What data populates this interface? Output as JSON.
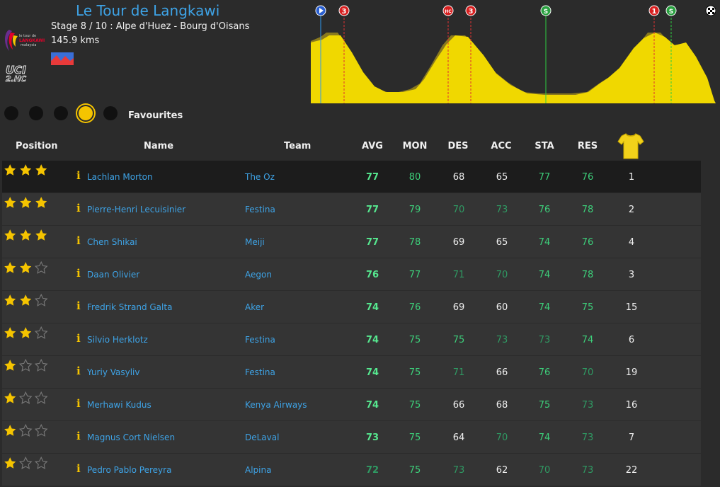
{
  "header": {
    "race_title": "Le Tour de Langkawi",
    "stage": "Stage 8 / 10 : Alpe d'Huez - Bourg d'Oisans",
    "distance": "145.9 kms",
    "race_logo_text": [
      "le tour de",
      "LANGKAWI",
      "malaysia"
    ],
    "uci_logo_text": [
      "UCI",
      "2.HC"
    ]
  },
  "profile": {
    "fill_color": "#f0d800",
    "markers": [
      "start",
      "3",
      "HC",
      "3",
      "S",
      "1",
      "S",
      "finish"
    ]
  },
  "filters": {
    "dots": 5,
    "active_dot": 3,
    "label": "Favourites"
  },
  "table": {
    "columns": {
      "position": "Position",
      "name": "Name",
      "team": "Team",
      "avg": "AVG",
      "mon": "MON",
      "des": "DES",
      "acc": "ACC",
      "sta": "STA",
      "res": "RES"
    },
    "rows": [
      {
        "stars": 3,
        "name": "Lachlan Morton",
        "team": "The Oz",
        "avg": "77",
        "mon": "80",
        "des": "68",
        "acc": "65",
        "sta": "77",
        "res": "76",
        "pos": "1"
      },
      {
        "stars": 3,
        "name": "Pierre-Henri Lecuisinier",
        "team": "Festina",
        "avg": "77",
        "mon": "79",
        "des": "70",
        "acc": "73",
        "sta": "76",
        "res": "78",
        "pos": "2"
      },
      {
        "stars": 3,
        "name": "Chen Shikai",
        "team": "Meiji",
        "avg": "77",
        "mon": "78",
        "des": "69",
        "acc": "65",
        "sta": "74",
        "res": "76",
        "pos": "4"
      },
      {
        "stars": 2,
        "name": "Daan Olivier",
        "team": "Aegon",
        "avg": "76",
        "mon": "77",
        "des": "71",
        "acc": "70",
        "sta": "74",
        "res": "78",
        "pos": "3"
      },
      {
        "stars": 2,
        "name": "Fredrik Strand Galta",
        "team": "Aker",
        "avg": "74",
        "mon": "76",
        "des": "69",
        "acc": "60",
        "sta": "74",
        "res": "75",
        "pos": "15"
      },
      {
        "stars": 2,
        "name": "Silvio Herklotz",
        "team": "Festina",
        "avg": "74",
        "mon": "75",
        "des": "75",
        "acc": "73",
        "sta": "73",
        "res": "74",
        "pos": "6"
      },
      {
        "stars": 1,
        "name": "Yuriy Vasyliv",
        "team": "Festina",
        "avg": "74",
        "mon": "75",
        "des": "71",
        "acc": "66",
        "sta": "76",
        "res": "70",
        "pos": "19"
      },
      {
        "stars": 1,
        "name": "Merhawi Kudus",
        "team": "Kenya Airways",
        "avg": "74",
        "mon": "75",
        "des": "66",
        "acc": "68",
        "sta": "75",
        "res": "73",
        "pos": "16"
      },
      {
        "stars": 1,
        "name": "Magnus Cort Nielsen",
        "team": "DeLaval",
        "avg": "73",
        "mon": "75",
        "des": "64",
        "acc": "70",
        "sta": "74",
        "res": "73",
        "pos": "7"
      },
      {
        "stars": 1,
        "name": "Pedro Pablo Pereyra",
        "team": "Alpina",
        "avg": "72",
        "mon": "75",
        "des": "73",
        "acc": "62",
        "sta": "70",
        "res": "73",
        "pos": "22"
      }
    ]
  },
  "colors": {
    "link": "#3ea3e6",
    "star": "#f5c400",
    "stat_high": "#3dcf7a",
    "stat_mid": "#2f9a63",
    "background": "#2b2b2b"
  }
}
